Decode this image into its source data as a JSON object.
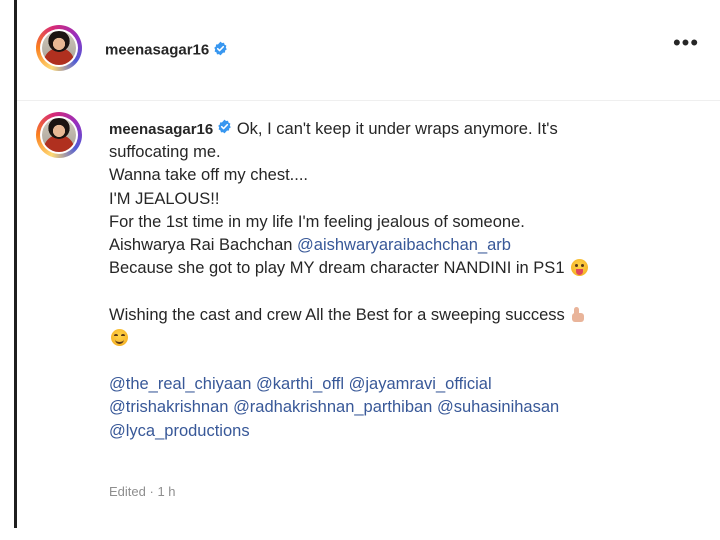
{
  "colors": {
    "text": "#262626",
    "mention": "#385898",
    "muted": "#8e8e8e",
    "verified": "#3897f0"
  },
  "header": {
    "username": "meenasagar16",
    "more_label": "•••"
  },
  "post": {
    "username": "meenasagar16",
    "caption": {
      "line1": "Ok, I can't keep it under wraps anymore. It's",
      "line2": "suffocating me.",
      "line3": "Wanna take off my chest....",
      "line4": "I'M JEALOUS!!",
      "line5": "For the 1st time in my life I'm feeling jealous of someone.",
      "line6_text": "Aishwarya Rai Bachchan ",
      "line6_mention": "@aishwaryaraibachchan_arb",
      "line7": "Because she got to play MY dream character NANDINI in PS1 ",
      "line8": "Wishing the cast and crew All the Best for a sweeping success "
    },
    "mentions": [
      "@the_real_chiyaan",
      "@karthi_offl",
      "@jayamravi_official",
      "@trishakrishnan",
      "@radhakrishnan_parthiban",
      "@suhasinihasan",
      "@lyca_productions"
    ],
    "edited_label": "Edited",
    "separator": " · ",
    "timestamp": "1 h"
  },
  "icons": {
    "verified": "verified-badge-icon",
    "more": "more-options-icon",
    "emoji_tongue": "face-with-tongue-emoji",
    "emoji_thumb": "thumbs-up-emoji",
    "emoji_smile": "smiling-face-emoji"
  }
}
